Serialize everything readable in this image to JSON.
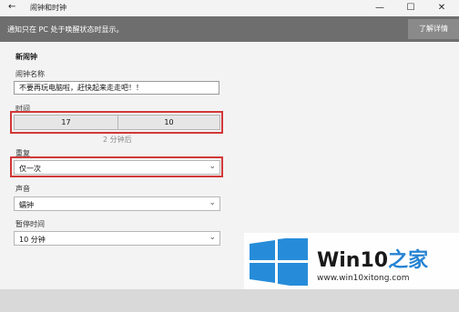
{
  "window": {
    "title": "闹钟和时钟",
    "back_glyph": "←",
    "min_glyph": "—",
    "max_glyph": "☐",
    "close_glyph": "✕"
  },
  "notification": {
    "text": "通知只在 PC 处于唤醒状态时显示。",
    "button_label": "了解详情"
  },
  "form": {
    "section_title": "新闹钟",
    "name_label": "闹钟名称",
    "name_value": "不要再玩电脑啦，赶快起来走走吧！！",
    "time_label": "时间",
    "hour": "17",
    "minute": "10",
    "time_hint": "2 分钟后",
    "repeat_label": "重复",
    "repeat_value": "仅一次",
    "sound_label": "声音",
    "sound_value": "蠕钟",
    "snooze_label": "暂停时间",
    "snooze_value": "10 分钟"
  },
  "watermark": {
    "brand_main": "Win10",
    "brand_accent": "之家",
    "url": "www.win10xitong.com",
    "colors": {
      "accent": "#1e7fd2",
      "logo": "#1e88d8"
    }
  },
  "colors": {
    "notification_bar": "#6e6e6e",
    "highlight_border": "#d23838"
  }
}
